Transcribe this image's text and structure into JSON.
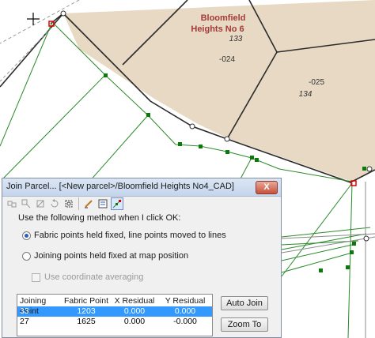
{
  "map": {
    "parcel_title": [
      "Bloomfield",
      "Heights No 6"
    ],
    "labels": [
      "133",
      "-024",
      "-025",
      "134"
    ],
    "colors": {
      "parcel_fill": "#e8d9c4",
      "parcel_label": "#a23a3a",
      "line_green": "#2a8a2a",
      "point_green": "#0a7a0a",
      "selected_point": "#e00000"
    }
  },
  "dialog": {
    "title": "Join Parcel... [<New parcel>/Bloomfield Heights No4_CAD]",
    "close_label": "X",
    "toolbar_icons": [
      "join-icon",
      "link-icon",
      "unlink-icon",
      "reset-icon",
      "zoom-extent-icon",
      "edit-icon",
      "properties-icon",
      "snap-points-icon"
    ],
    "method_label": "Use the following method when I click OK:",
    "options": [
      {
        "label": "Fabric points held fixed, line points moved to lines",
        "selected": true
      },
      {
        "label": "Joining points held fixed at map position",
        "selected": false
      }
    ],
    "coordinate_averaging": {
      "label": "Use coordinate averaging",
      "enabled": false,
      "checked": false
    },
    "table": {
      "columns": [
        "Joining Point",
        "Fabric Point",
        "X Residual",
        "Y Residual"
      ],
      "rows": [
        [
          "33",
          "1203",
          "0.000",
          "0.000"
        ],
        [
          "27",
          "1625",
          "0.000",
          "-0.000"
        ]
      ],
      "selected_row": 0
    },
    "buttons": {
      "auto_join": "Auto Join",
      "zoom_to": "Zoom To"
    }
  }
}
